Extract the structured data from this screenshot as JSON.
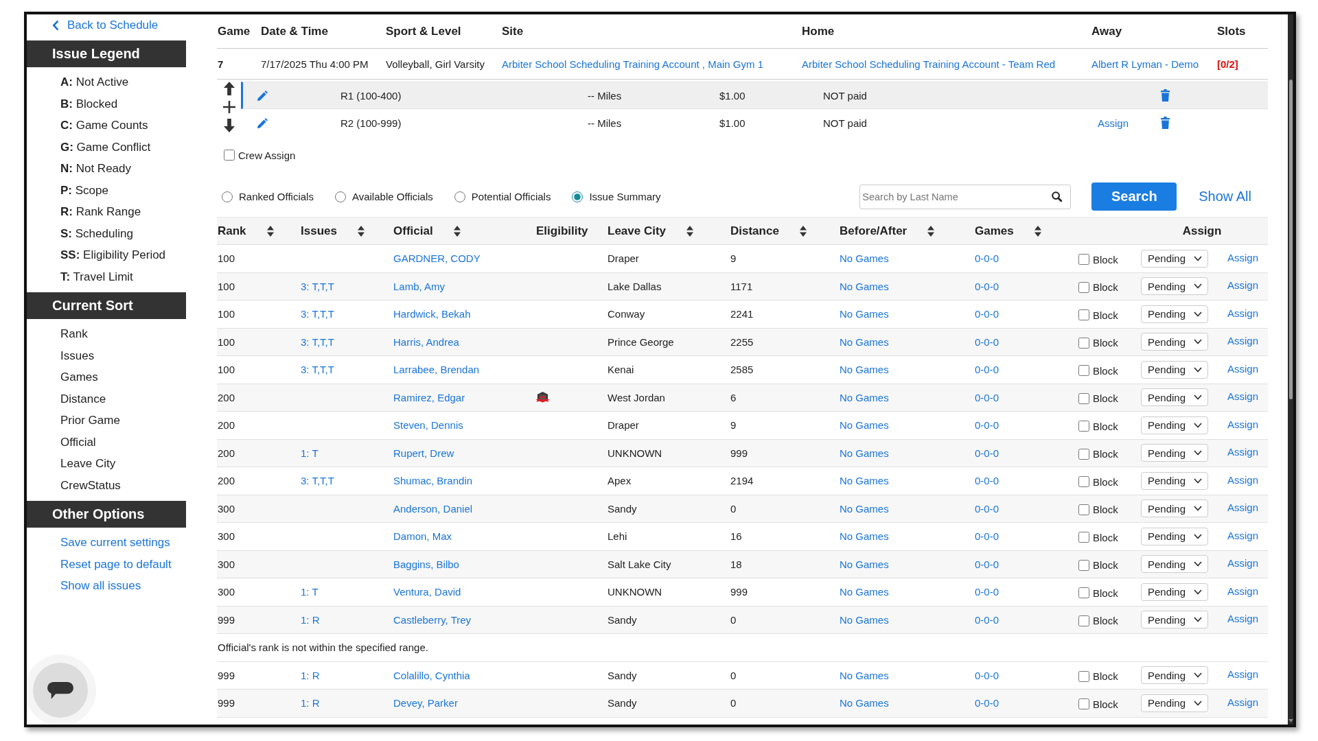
{
  "sidebar": {
    "back_link": "Back to Schedule",
    "sections": [
      {
        "title": "Issue Legend",
        "kind": "legend",
        "items": [
          "**A:** Not Active",
          "**B:** Blocked",
          "**C:** Game Counts",
          "**G:** Game Conflict",
          "**N:** Not Ready",
          "**P:** Scope",
          "**R:** Rank Range",
          "**S:** Scheduling",
          "**SS:** Eligibility Period",
          "**T:** Travel Limit"
        ]
      },
      {
        "title": "Current Sort",
        "kind": "sort",
        "items": [
          "Rank",
          "Issues",
          "Games",
          "Distance",
          "Prior Game",
          "Official",
          "Leave City",
          "CrewStatus"
        ]
      },
      {
        "title": "Other Options",
        "kind": "links",
        "items": [
          "Save current settings",
          "Reset page to default",
          "Show all issues"
        ]
      }
    ]
  },
  "game": {
    "columns": [
      "Game",
      "Date & Time",
      "Sport & Level",
      "Site",
      "Home",
      "Away",
      "Slots"
    ],
    "cells": [
      {
        "kind": "number",
        "text": "7"
      },
      {
        "kind": "date",
        "text": "7/17/2025 Thu 4:00 PM"
      },
      {
        "kind": "text",
        "text": "Volleyball, Girl Varsity"
      },
      {
        "kind": "link",
        "text": "Arbiter School Scheduling Training Account , Main Gym 1"
      },
      {
        "kind": "link",
        "text": "Arbiter School Scheduling Training Account - Team Red"
      },
      {
        "kind": "link",
        "text": "Albert R Lyman - Demo"
      },
      {
        "kind": "slots",
        "text": "[0/2]"
      }
    ],
    "positions": [
      {
        "name": "R1 (100-400)",
        "distance": "-- Miles",
        "fee": "$1.00",
        "payment": "NOT paid",
        "selected": true
      },
      {
        "name": "R2 (100-999)",
        "distance": "-- Miles",
        "fee": "$1.00",
        "payment": "NOT paid",
        "assign": "Assign",
        "selected": false
      }
    ],
    "crew_assign": {
      "label": "Crew Assign",
      "checked": false
    }
  },
  "filters": {
    "views": [
      {
        "label": "Ranked Officials",
        "selected": false
      },
      {
        "label": "Available Officials",
        "selected": false
      },
      {
        "label": "Potential Officials",
        "selected": false
      },
      {
        "label": "Issue Summary",
        "selected": true
      }
    ],
    "search": {
      "placeholder": "Search by Last Name"
    },
    "search_button": "Search",
    "show_all": "Show All"
  },
  "officials": {
    "columns": [
      {
        "label": "Rank",
        "kind": "sortable"
      },
      {
        "label": "Issues",
        "kind": "sortable"
      },
      {
        "label": "Official",
        "kind": "sortable"
      },
      {
        "label": "Eligibility",
        "kind": "plain"
      },
      {
        "label": "Leave City",
        "kind": "sortable"
      },
      {
        "label": "Distance",
        "kind": "sortable"
      },
      {
        "label": "Before/After",
        "kind": "sortable"
      },
      {
        "label": "Games",
        "kind": "sortable"
      },
      {
        "label": "Assign",
        "kind": "action"
      }
    ],
    "rows": [
      {
        "kind": "official",
        "rank": "100",
        "official": "GARDNER, CODY",
        "eligibility_flag": false,
        "leave_city": "Draper",
        "distance": "9",
        "before_after": "No Games",
        "games": "0-0-0",
        "block": {
          "label": "Block",
          "checked": false
        },
        "status": "Pending",
        "assign": "Assign"
      },
      {
        "kind": "official",
        "rank": "100",
        "issues": "3: T,T,T",
        "official": "Lamb, Amy",
        "eligibility_flag": false,
        "leave_city": "Lake Dallas",
        "distance": "1171",
        "before_after": "No Games",
        "games": "0-0-0",
        "block": {
          "label": "Block",
          "checked": false
        },
        "status": "Pending",
        "assign": "Assign"
      },
      {
        "kind": "official",
        "rank": "100",
        "issues": "3: T,T,T",
        "official": "Hardwick, Bekah",
        "eligibility_flag": false,
        "leave_city": "Conway",
        "distance": "2241",
        "before_after": "No Games",
        "games": "0-0-0",
        "block": {
          "label": "Block",
          "checked": false
        },
        "status": "Pending",
        "assign": "Assign"
      },
      {
        "kind": "official",
        "rank": "100",
        "issues": "3: T,T,T",
        "official": "Harris, Andrea",
        "eligibility_flag": false,
        "leave_city": "Prince George",
        "distance": "2255",
        "before_after": "No Games",
        "games": "0-0-0",
        "block": {
          "label": "Block",
          "checked": false
        },
        "status": "Pending",
        "assign": "Assign"
      },
      {
        "kind": "official",
        "rank": "100",
        "issues": "3: T,T,T",
        "official": "Larrabee, Brendan",
        "eligibility_flag": false,
        "leave_city": "Kenai",
        "distance": "2585",
        "before_after": "No Games",
        "games": "0-0-0",
        "block": {
          "label": "Block",
          "checked": false
        },
        "status": "Pending",
        "assign": "Assign"
      },
      {
        "kind": "official",
        "rank": "200",
        "official": "Ramirez, Edgar",
        "eligibility_flag": true,
        "leave_city": "West Jordan",
        "distance": "6",
        "before_after": "No Games",
        "games": "0-0-0",
        "block": {
          "label": "Block",
          "checked": false
        },
        "status": "Pending",
        "assign": "Assign"
      },
      {
        "kind": "official",
        "rank": "200",
        "official": "Steven, Dennis",
        "eligibility_flag": false,
        "leave_city": "Draper",
        "distance": "9",
        "before_after": "No Games",
        "games": "0-0-0",
        "block": {
          "label": "Block",
          "checked": false
        },
        "status": "Pending",
        "assign": "Assign"
      },
      {
        "kind": "official",
        "rank": "200",
        "issues": "1: T",
        "official": "Rupert, Drew",
        "eligibility_flag": false,
        "leave_city": "UNKNOWN",
        "distance": "999",
        "before_after": "No Games",
        "games": "0-0-0",
        "block": {
          "label": "Block",
          "checked": false
        },
        "status": "Pending",
        "assign": "Assign"
      },
      {
        "kind": "official",
        "rank": "200",
        "issues": "3: T,T,T",
        "official": "Shumac, Brandin",
        "eligibility_flag": false,
        "leave_city": "Apex",
        "distance": "2194",
        "before_after": "No Games",
        "games": "0-0-0",
        "block": {
          "label": "Block",
          "checked": false
        },
        "status": "Pending",
        "assign": "Assign"
      },
      {
        "kind": "official",
        "rank": "300",
        "official": "Anderson, Daniel",
        "eligibility_flag": false,
        "leave_city": "Sandy",
        "distance": "0",
        "before_after": "No Games",
        "games": "0-0-0",
        "block": {
          "label": "Block",
          "checked": false
        },
        "status": "Pending",
        "assign": "Assign"
      },
      {
        "kind": "official",
        "rank": "300",
        "official": "Damon, Max",
        "eligibility_flag": false,
        "leave_city": "Lehi",
        "distance": "16",
        "before_after": "No Games",
        "games": "0-0-0",
        "block": {
          "label": "Block",
          "checked": false
        },
        "status": "Pending",
        "assign": "Assign"
      },
      {
        "kind": "official",
        "rank": "300",
        "official": "Baggins, Bilbo",
        "eligibility_flag": false,
        "leave_city": "Salt Lake City",
        "distance": "18",
        "before_after": "No Games",
        "games": "0-0-0",
        "block": {
          "label": "Block",
          "checked": false
        },
        "status": "Pending",
        "assign": "Assign"
      },
      {
        "kind": "official",
        "rank": "300",
        "issues": "1: T",
        "official": "Ventura, David",
        "eligibility_flag": false,
        "leave_city": "UNKNOWN",
        "distance": "999",
        "before_after": "No Games",
        "games": "0-0-0",
        "block": {
          "label": "Block",
          "checked": false
        },
        "status": "Pending",
        "assign": "Assign"
      },
      {
        "kind": "official",
        "rank": "999",
        "issues": "1: R",
        "official": "Castleberry, Trey",
        "eligibility_flag": false,
        "leave_city": "Sandy",
        "distance": "0",
        "before_after": "No Games",
        "games": "0-0-0",
        "block": {
          "label": "Block",
          "checked": false
        },
        "status": "Pending",
        "assign": "Assign"
      },
      {
        "kind": "note",
        "text": "Official's rank is not within the specified range."
      },
      {
        "kind": "official",
        "rank": "999",
        "issues": "1: R",
        "official": "Colalillo, Cynthia",
        "eligibility_flag": false,
        "leave_city": "Sandy",
        "distance": "0",
        "before_after": "No Games",
        "games": "0-0-0",
        "block": {
          "label": "Block",
          "checked": false
        },
        "status": "Pending",
        "assign": "Assign"
      },
      {
        "kind": "official",
        "rank": "999",
        "issues": "1: R",
        "official": "Devey, Parker",
        "eligibility_flag": false,
        "leave_city": "Sandy",
        "distance": "0",
        "before_after": "No Games",
        "games": "0-0-0",
        "block": {
          "label": "Block",
          "checked": false
        },
        "status": "Pending",
        "assign": "Assign"
      }
    ]
  }
}
